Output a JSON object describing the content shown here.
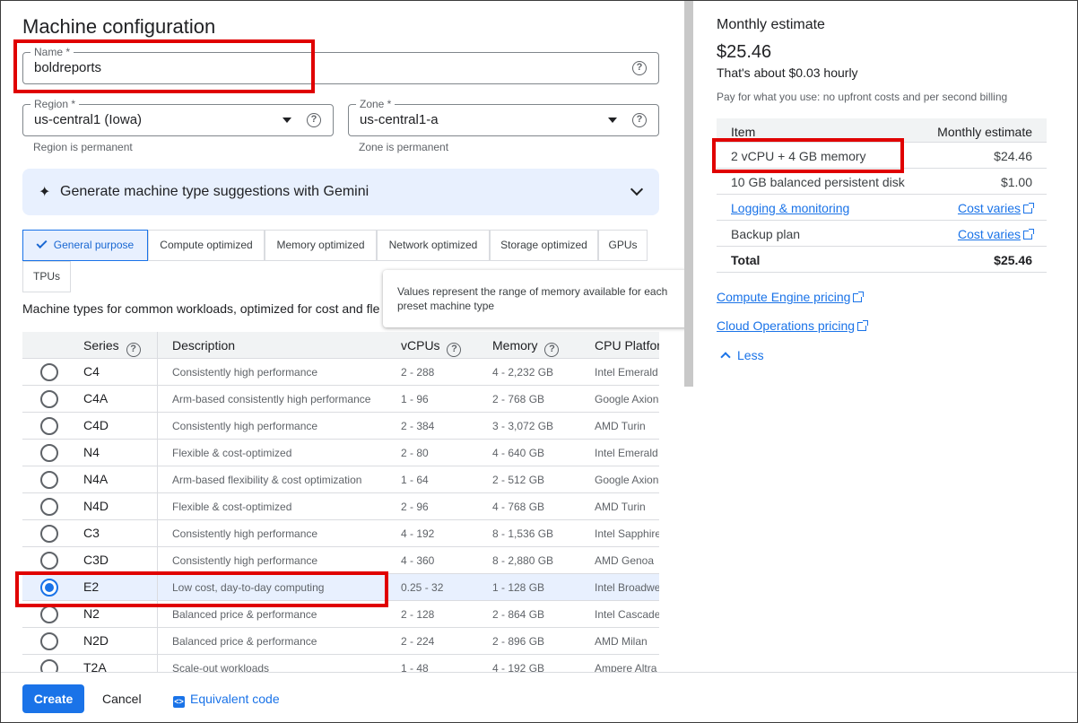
{
  "page_title": "Machine configuration",
  "name_field": {
    "label": "Name *",
    "value": "boldreports"
  },
  "region_field": {
    "label": "Region *",
    "value": "us-central1 (Iowa)",
    "hint": "Region is permanent"
  },
  "zone_field": {
    "label": "Zone *",
    "value": "us-central1-a",
    "hint": "Zone is permanent"
  },
  "gemini": {
    "label": "Generate machine type suggestions with Gemini"
  },
  "tabs": [
    {
      "label": "General purpose",
      "active": true
    },
    {
      "label": "Compute optimized"
    },
    {
      "label": "Memory optimized"
    },
    {
      "label": "Network optimized"
    },
    {
      "label": "Storage optimized"
    },
    {
      "label": "GPUs"
    },
    {
      "label": "TPUs"
    }
  ],
  "description": "Machine types for common workloads, optimized for cost and fle",
  "tooltip": {
    "text": "Values represent the range of memory available for each preset machine type"
  },
  "table": {
    "headers": {
      "series": "Series",
      "description": "Description",
      "vcpus": "vCPUs",
      "memory": "Memory",
      "cpu": "CPU Platfor"
    },
    "rows": [
      {
        "series": "C4",
        "description": "Consistently high performance",
        "vcpus": "2 - 288",
        "memory": "4 - 2,232 GB",
        "cpu": "Intel Emerald"
      },
      {
        "series": "C4A",
        "description": "Arm-based consistently high performance",
        "vcpus": "1 - 96",
        "memory": "2 - 768 GB",
        "cpu": "Google Axion"
      },
      {
        "series": "C4D",
        "description": "Consistently high performance",
        "vcpus": "2 - 384",
        "memory": "3 - 3,072 GB",
        "cpu": "AMD Turin"
      },
      {
        "series": "N4",
        "description": "Flexible & cost-optimized",
        "vcpus": "2 - 80",
        "memory": "4 - 640 GB",
        "cpu": "Intel Emerald"
      },
      {
        "series": "N4A",
        "description": "Arm-based flexibility & cost optimization",
        "vcpus": "1 - 64",
        "memory": "2 - 512 GB",
        "cpu": "Google Axion"
      },
      {
        "series": "N4D",
        "description": "Flexible & cost-optimized",
        "vcpus": "2 - 96",
        "memory": "4 - 768 GB",
        "cpu": "AMD Turin"
      },
      {
        "series": "C3",
        "description": "Consistently high performance",
        "vcpus": "4 - 192",
        "memory": "8 - 1,536 GB",
        "cpu": "Intel Sapphire"
      },
      {
        "series": "C3D",
        "description": "Consistently high performance",
        "vcpus": "4 - 360",
        "memory": "8 - 2,880 GB",
        "cpu": "AMD Genoa"
      },
      {
        "series": "E2",
        "description": "Low cost, day-to-day computing",
        "vcpus": "0.25 - 32",
        "memory": "1 - 128 GB",
        "cpu": "Intel Broadwe",
        "selected": true
      },
      {
        "series": "N2",
        "description": "Balanced price & performance",
        "vcpus": "2 - 128",
        "memory": "2 - 864 GB",
        "cpu": "Intel Cascade"
      },
      {
        "series": "N2D",
        "description": "Balanced price & performance",
        "vcpus": "2 - 224",
        "memory": "2 - 896 GB",
        "cpu": "AMD Milan"
      },
      {
        "series": "T2A",
        "description": "Scale-out workloads",
        "vcpus": "1 - 48",
        "memory": "4 - 192 GB",
        "cpu": "Ampere Altra"
      }
    ]
  },
  "estimate": {
    "title": "Monthly estimate",
    "price": "$25.46",
    "hourly": "That's about $0.03 hourly",
    "note": "Pay for what you use: no upfront costs and per second billing",
    "head_item": "Item",
    "head_estimate": "Monthly estimate",
    "rows": [
      {
        "item": "2 vCPU + 4 GB memory",
        "value": "$24.46"
      },
      {
        "item": "10 GB balanced persistent disk",
        "value": "$1.00"
      },
      {
        "item": "Logging & monitoring",
        "value": "Cost varies"
      },
      {
        "item": "Backup plan",
        "value": "Cost varies"
      },
      {
        "item": "Total",
        "value": "$25.46"
      }
    ],
    "link_compute": "Compute Engine pricing",
    "link_ops": "Cloud Operations pricing",
    "less": "Less"
  },
  "footer": {
    "create": "Create",
    "cancel": "Cancel",
    "code": "Equivalent code"
  },
  "colors": {
    "accent": "#1a73e8",
    "annotation": "#e00000",
    "selected_row": "#e8f0fe"
  },
  "icons": [
    "help-icon",
    "dropdown-arrow-icon",
    "gemini-spark-icon",
    "chevron-down-icon",
    "check-icon",
    "close-icon",
    "radio-icon",
    "external-link-icon",
    "chevron-up-icon",
    "code-icon"
  ]
}
